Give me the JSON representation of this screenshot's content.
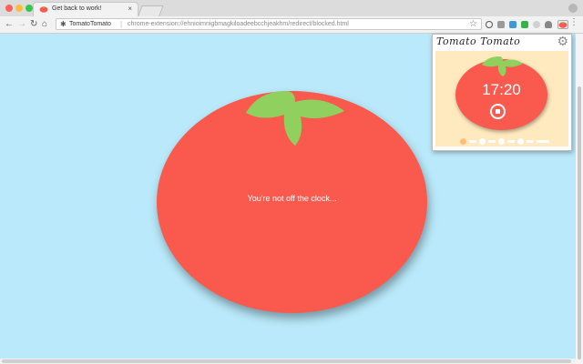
{
  "browser": {
    "traffic_colors": [
      "#fc605b",
      "#fdbc40",
      "#34c84a"
    ],
    "tab": {
      "title": "Get back to work!",
      "close": "×",
      "favicon": "tomato-favicon-icon"
    },
    "nav": {
      "back": "←",
      "forward": "→",
      "reload": "↻",
      "home": "⌂"
    },
    "omnibox": {
      "site_name": "TomatoTomato",
      "separator": "|",
      "url": "chrome-extension://ehnioimnigbmagkiloadeebcchjeakhm/redirect/blocked.html",
      "star": "☆"
    },
    "menu": "⋮"
  },
  "page": {
    "message": "You're not off the clock...",
    "colors": {
      "background": "#b9e9fa",
      "tomato": "#fa5a4d",
      "leaf": "#8fd05f"
    }
  },
  "popup": {
    "title": "Tomato Tomato",
    "settings_icon": "⚙",
    "timer": "17:20",
    "progress": {
      "completed": 1,
      "total": 5
    },
    "colors": {
      "panel": "#ffe9bf",
      "progress_active": "#ffbf78"
    }
  }
}
